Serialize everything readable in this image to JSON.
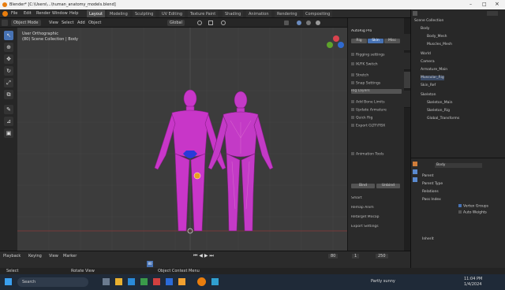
{
  "window": {
    "title": "Blender* [C:\\Users\\...\\human_anatomy_models.blend]"
  },
  "menus": [
    "File",
    "Edit",
    "Render",
    "Window",
    "Help"
  ],
  "workspaces": [
    "Layout",
    "Modeling",
    "Sculpting",
    "UV Editing",
    "Texture Paint",
    "Shading",
    "Animation",
    "Rendering",
    "Compositing"
  ],
  "header3d": {
    "mode": "Object Mode",
    "view": "View",
    "select": "Select",
    "add": "Add",
    "object": "Object",
    "orientation": "Global"
  },
  "viewport": {
    "view_name": "User Orthographic",
    "collection": "(80) Scene Collection | Body"
  },
  "npanel": {
    "title": "AutoRig Pro",
    "tabs": [
      "Rig",
      "Skin",
      "Misc"
    ],
    "rows": [
      "Rigging settings",
      "IK/FK Switch",
      "Stretch",
      "Snap Settings",
      "Rig Layers",
      "Add Bone Limits",
      "Update Armature",
      "Quick Rig",
      "Export GLTF/FBX",
      "Animation Tools"
    ],
    "buttons": [
      "Bind",
      "Unbind"
    ],
    "sections": [
      "Smart",
      "Remap Anim",
      "Retarget Mocap",
      "Export Settings"
    ]
  },
  "outliner": {
    "header": "Scene Collection",
    "items": [
      {
        "label": "Body",
        "depth": 1
      },
      {
        "label": "Body_Mesh",
        "depth": 2
      },
      {
        "label": "Muscles_Mesh",
        "depth": 2
      },
      {
        "label": "World",
        "depth": 1
      },
      {
        "label": "Camera",
        "depth": 1
      },
      {
        "label": "Armature_Main",
        "depth": 1
      },
      {
        "label": "Muscular_Rig",
        "depth": 1
      },
      {
        "label": "Skin_Ref",
        "depth": 1
      },
      {
        "label": "Skeleton",
        "depth": 1
      },
      {
        "label": "Skeleton_Main",
        "depth": 2
      },
      {
        "label": "Skeleton_Rig",
        "depth": 2
      },
      {
        "label": "Global_Transforms",
        "depth": 2
      }
    ]
  },
  "properties": {
    "object_name": "Body",
    "fields": [
      "Parent",
      "Parent Type",
      "Relations",
      "Pass Index",
      "Inherit"
    ],
    "bind_options": [
      "Vertex Groups",
      "Auto Weights"
    ]
  },
  "timeline": {
    "playback": "Playback",
    "keying": "Keying",
    "view": "View",
    "marker": "Marker",
    "frame": "80",
    "start": "1",
    "end": "250"
  },
  "status": {
    "select": "Select",
    "rotate": "Rotate View",
    "context": "Object Context Menu"
  },
  "taskbar": {
    "search": "Search",
    "weather": "Partly sunny",
    "time": "11:04 PM",
    "date": "1/4/2024"
  }
}
